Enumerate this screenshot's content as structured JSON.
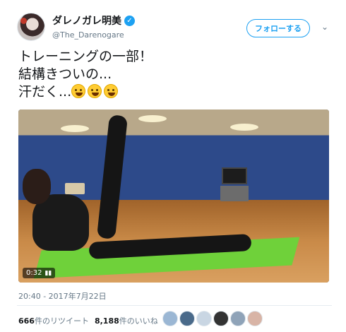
{
  "user": {
    "display_name": "ダレノガレ明美",
    "verified_mark": "✓",
    "handle": "@The_Darenogare"
  },
  "follow_button": {
    "label": "フォローする"
  },
  "menu_icon": "chevron-down-icon",
  "tweet": {
    "lines": [
      "トレーニングの一部！",
      "結構きついの...",
      "汗だく..."
    ],
    "emoji_count": 3
  },
  "video": {
    "duration": "0:32",
    "sound_icon": "speaker-icon"
  },
  "timestamp": "20:40 - 2017年7月22日",
  "stats": {
    "retweets_count": "666",
    "retweets_label": "件のリツイート",
    "likes_count": "8,188",
    "likes_label": "件のいいね"
  },
  "likers": [
    {
      "color": "#9bb7d4"
    },
    {
      "color": "#4a6a8a"
    },
    {
      "color": "#c9d6e3"
    },
    {
      "color": "#333333"
    },
    {
      "color": "#8fa3b8"
    },
    {
      "color": "#d8b4a6"
    }
  ]
}
